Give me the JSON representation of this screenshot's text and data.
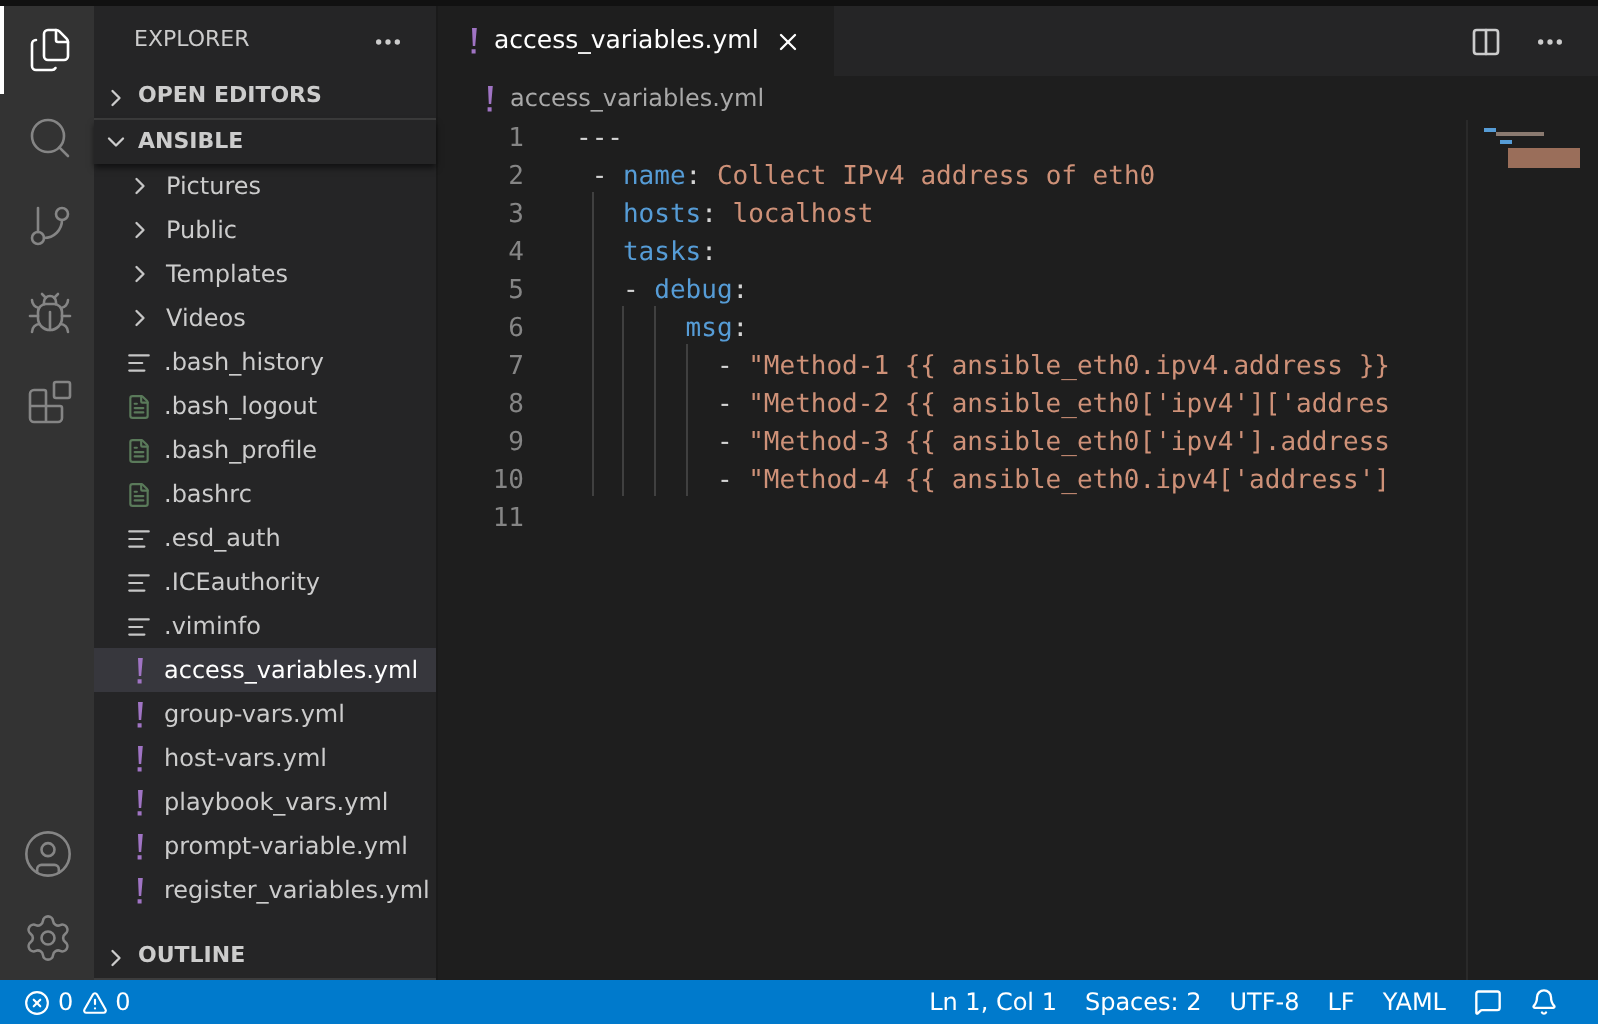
{
  "activity_bar": {
    "items": [
      {
        "kind": "files",
        "selected": true
      },
      {
        "kind": "search",
        "selected": false
      },
      {
        "kind": "source-control",
        "selected": false
      },
      {
        "kind": "run",
        "selected": false
      },
      {
        "kind": "extensions",
        "selected": false
      }
    ],
    "bottom": [
      {
        "kind": "account"
      },
      {
        "kind": "settings"
      }
    ]
  },
  "sidebar": {
    "title": "EXPLORER",
    "sections": [
      {
        "label": "OPEN EDITORS",
        "expanded": false
      },
      {
        "label": "ANSIBLE",
        "expanded": true
      }
    ],
    "items": [
      {
        "kind": "folder",
        "name": "Pictures",
        "selected": false
      },
      {
        "kind": "folder",
        "name": "Public",
        "selected": false
      },
      {
        "kind": "folder",
        "name": "Templates",
        "selected": false
      },
      {
        "kind": "folder",
        "name": "Videos",
        "selected": false
      },
      {
        "kind": "text",
        "name": ".bash_history",
        "selected": false
      },
      {
        "kind": "shell",
        "name": ".bash_logout",
        "selected": false
      },
      {
        "kind": "shell",
        "name": ".bash_profile",
        "selected": false
      },
      {
        "kind": "shell",
        "name": ".bashrc",
        "selected": false
      },
      {
        "kind": "text",
        "name": ".esd_auth",
        "selected": false
      },
      {
        "kind": "text",
        "name": ".ICEauthority",
        "selected": false
      },
      {
        "kind": "text",
        "name": ".viminfo",
        "selected": false
      },
      {
        "kind": "yaml",
        "name": "access_variables.yml",
        "selected": true
      },
      {
        "kind": "yaml",
        "name": "group-vars.yml",
        "selected": false
      },
      {
        "kind": "yaml",
        "name": "host-vars.yml",
        "selected": false
      },
      {
        "kind": "yaml",
        "name": "playbook_vars.yml",
        "selected": false
      },
      {
        "kind": "yaml",
        "name": "prompt-variable.yml",
        "selected": false
      },
      {
        "kind": "yaml",
        "name": "register_variables.yml",
        "selected": false
      }
    ],
    "outline": {
      "label": "OUTLINE",
      "expanded": false
    }
  },
  "editor": {
    "tabs": [
      {
        "label": "access_variables.yml",
        "selected": true
      }
    ],
    "breadcrumb": "access_variables.yml",
    "lines": [
      {
        "number": "1",
        "tokens": [
          {
            "kind": "punct",
            "text": "---"
          }
        ]
      },
      {
        "number": "2",
        "tokens": [
          {
            "kind": "punct",
            "text": " - "
          },
          {
            "kind": "key",
            "text": "name"
          },
          {
            "kind": "punct",
            "text": ": "
          },
          {
            "kind": "string",
            "text": "Collect IPv4 address of eth0"
          }
        ]
      },
      {
        "number": "3",
        "tokens": [
          {
            "kind": "key",
            "text": "   hosts"
          },
          {
            "kind": "punct",
            "text": ": "
          },
          {
            "kind": "string",
            "text": "localhost"
          }
        ]
      },
      {
        "number": "4",
        "tokens": [
          {
            "kind": "key",
            "text": "   tasks"
          },
          {
            "kind": "punct",
            "text": ":"
          }
        ]
      },
      {
        "number": "5",
        "tokens": [
          {
            "kind": "punct",
            "text": "   - "
          },
          {
            "kind": "key",
            "text": "debug"
          },
          {
            "kind": "punct",
            "text": ":"
          }
        ]
      },
      {
        "number": "6",
        "tokens": [
          {
            "kind": "key",
            "text": "       msg"
          },
          {
            "kind": "punct",
            "text": ":"
          }
        ]
      },
      {
        "number": "7",
        "tokens": [
          {
            "kind": "punct",
            "text": "         - "
          },
          {
            "kind": "string",
            "text": "\"Method-1 {{ ansible_eth0.ipv4.address }}"
          }
        ]
      },
      {
        "number": "8",
        "tokens": [
          {
            "kind": "punct",
            "text": "         - "
          },
          {
            "kind": "string",
            "text": "\"Method-2 {{ ansible_eth0['ipv4']['addres"
          }
        ]
      },
      {
        "number": "9",
        "tokens": [
          {
            "kind": "punct",
            "text": "         - "
          },
          {
            "kind": "string",
            "text": "\"Method-3 {{ ansible_eth0['ipv4'].address"
          }
        ]
      },
      {
        "number": "10",
        "tokens": [
          {
            "kind": "punct",
            "text": "         - "
          },
          {
            "kind": "string",
            "text": "\"Method-4 {{ ansible_eth0.ipv4['address']"
          }
        ]
      },
      {
        "number": "11"
      }
    ]
  },
  "status_bar": {
    "errors": "0",
    "warnings": "0",
    "items": [
      "Ln 1, Col 1",
      "Spaces: 2",
      "UTF-8",
      "LF",
      "YAML"
    ]
  }
}
